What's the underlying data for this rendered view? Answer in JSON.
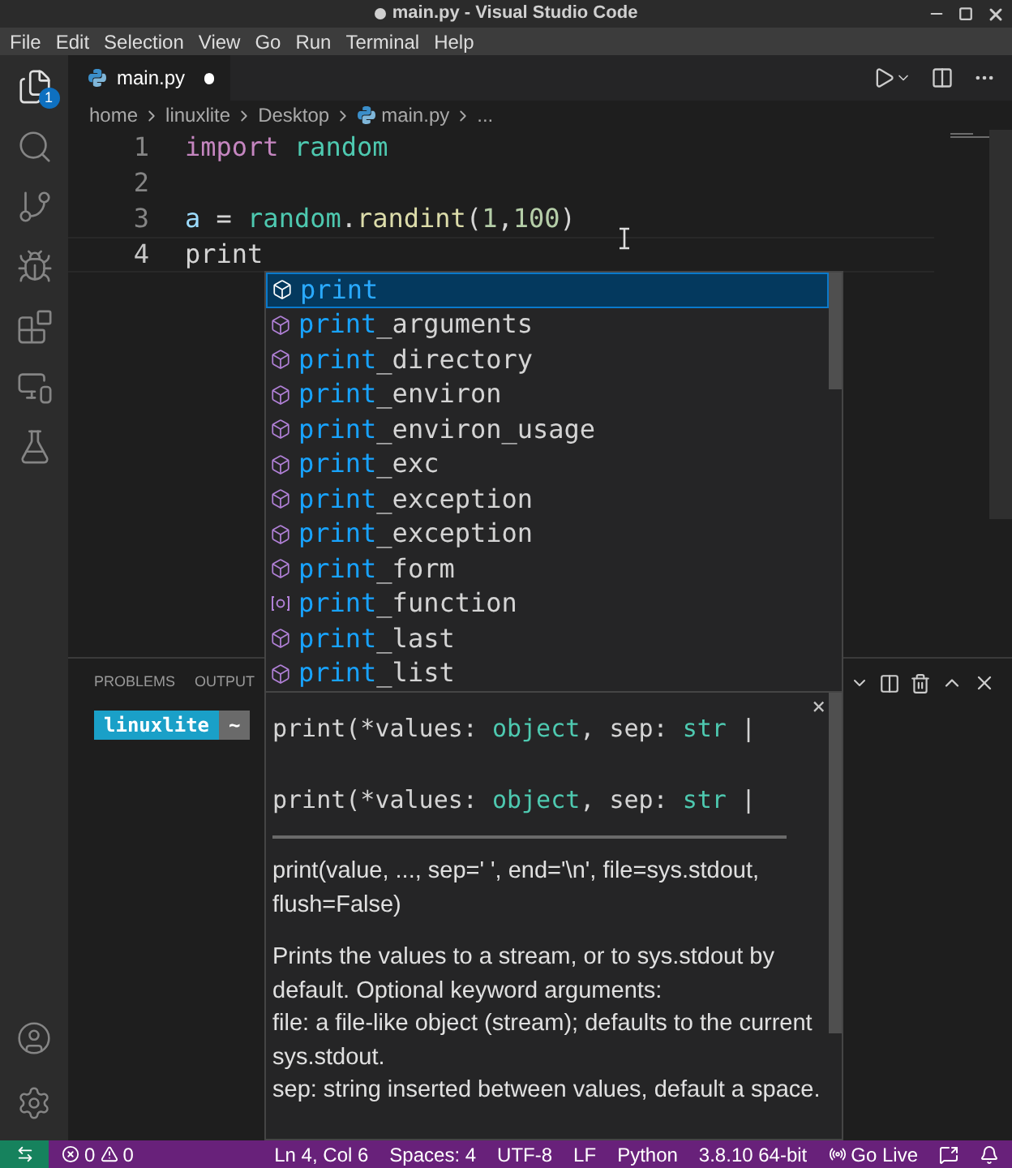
{
  "window": {
    "title": "main.py - Visual Studio Code",
    "modified": true
  },
  "menu": [
    "File",
    "Edit",
    "Selection",
    "View",
    "Go",
    "Run",
    "Terminal",
    "Help"
  ],
  "activity_bar": {
    "top": [
      {
        "kind": "files",
        "badge": "1",
        "selected": true
      },
      {
        "kind": "search",
        "selected": false
      },
      {
        "kind": "source-control",
        "selected": false
      },
      {
        "kind": "debug",
        "selected": false
      },
      {
        "kind": "extensions",
        "selected": false
      },
      {
        "kind": "remote",
        "selected": false
      },
      {
        "kind": "testing",
        "selected": false
      }
    ],
    "bottom": [
      {
        "kind": "account"
      },
      {
        "kind": "settings"
      }
    ]
  },
  "tabs": [
    {
      "label": "main.py",
      "selected": true,
      "modified": true
    }
  ],
  "breadcrumb": [
    {
      "label": "home",
      "kind": "folder"
    },
    {
      "label": "linuxlite",
      "kind": "folder"
    },
    {
      "label": "Desktop",
      "kind": "folder"
    },
    {
      "label": "main.py",
      "kind": "python"
    },
    {
      "label": "...",
      "kind": "more"
    }
  ],
  "editor": {
    "lines": [
      {
        "number": "1",
        "tokens": [
          {
            "text": "import",
            "kind": "keyword"
          },
          {
            "text": " random",
            "kind": "module"
          }
        ],
        "current": false
      },
      {
        "number": "2",
        "current": false
      },
      {
        "number": "3",
        "tokens": [
          {
            "text": "a",
            "kind": "variable"
          },
          {
            "text": " = ",
            "kind": "plain"
          },
          {
            "text": "random",
            "kind": "module"
          },
          {
            "text": ".",
            "kind": "plain"
          },
          {
            "text": "randint",
            "kind": "function"
          },
          {
            "text": "(",
            "kind": "plain"
          },
          {
            "text": "1",
            "kind": "number"
          },
          {
            "text": ",",
            "kind": "plain"
          },
          {
            "text": "100",
            "kind": "number"
          },
          {
            "text": ")",
            "kind": "plain"
          }
        ],
        "current": false
      },
      {
        "number": "4",
        "tokens": [
          {
            "text": "print",
            "kind": "plain"
          }
        ],
        "current": true
      }
    ]
  },
  "suggestions": [
    {
      "match": "print",
      "kind": "module",
      "selected": true
    },
    {
      "match": "print",
      "rest": "_arguments",
      "kind": "module",
      "selected": false
    },
    {
      "match": "print",
      "rest": "_directory",
      "kind": "module",
      "selected": false
    },
    {
      "match": "print",
      "rest": "_environ",
      "kind": "module",
      "selected": false
    },
    {
      "match": "print",
      "rest": "_environ_usage",
      "kind": "module",
      "selected": false
    },
    {
      "match": "print",
      "rest": "_exc",
      "kind": "module",
      "selected": false
    },
    {
      "match": "print",
      "rest": "_exception",
      "kind": "module",
      "selected": false
    },
    {
      "match": "print",
      "rest": "_exception",
      "kind": "module",
      "selected": false
    },
    {
      "match": "print",
      "rest": "_form",
      "kind": "module",
      "selected": false
    },
    {
      "match": "print",
      "rest": "_function",
      "kind": "variable",
      "selected": false
    },
    {
      "match": "print",
      "rest": "_last",
      "kind": "module",
      "selected": false
    },
    {
      "match": "print",
      "rest": "_list",
      "kind": "module",
      "selected": false
    }
  ],
  "hover": {
    "signatures": [
      [
        {
          "text": "print(*values: ",
          "kind": "plain"
        },
        {
          "text": "object",
          "kind": "type"
        },
        {
          "text": ", sep: ",
          "kind": "plain"
        },
        {
          "text": "str",
          "kind": "type"
        },
        {
          "text": " |",
          "kind": "plain"
        }
      ],
      [
        {
          "text": "print(*values: ",
          "kind": "plain"
        },
        {
          "text": "object",
          "kind": "type"
        },
        {
          "text": ", sep: ",
          "kind": "plain"
        },
        {
          "text": "str",
          "kind": "type"
        },
        {
          "text": " |",
          "kind": "plain"
        }
      ]
    ],
    "close": "×",
    "docs": [
      "print(value, ..., sep=' ', end='\\n', file=sys.stdout, flush=False)",
      "Prints the values to a stream, or to sys.stdout by default. Optional keyword arguments:\nfile: a file-like object (stream); defaults to the current sys.stdout.\nsep: string inserted between values, default a space."
    ]
  },
  "panel": {
    "tabs": [
      {
        "label": "PROBLEMS",
        "selected": false
      },
      {
        "label": "OUTPUT",
        "selected": false
      }
    ],
    "terminal": {
      "user": "linuxlite",
      "dir": "~"
    }
  },
  "status_bar": {
    "errors": "0",
    "warnings": "0",
    "items": [
      "Ln 4, Col 6",
      "Spaces: 4",
      "UTF-8",
      "LF",
      "Python",
      "3.8.10 64-bit"
    ],
    "go_live": "Go Live"
  }
}
